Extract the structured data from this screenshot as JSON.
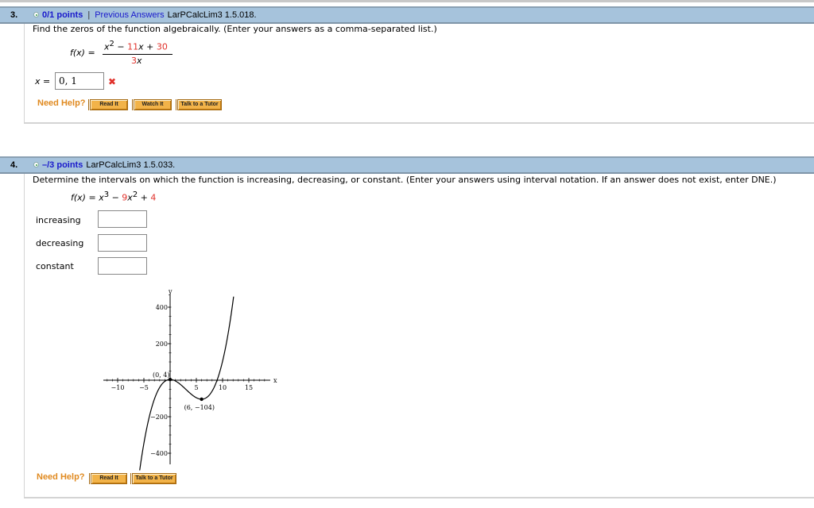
{
  "questions": [
    {
      "number": "3.",
      "points": "0/1 points",
      "separator": "|",
      "previous_answers": "Previous Answers",
      "reference": "LarPCalcLim3 1.5.018.",
      "prompt": "Find the zeros of the function algebraically. (Enter your answers as a comma-separated list.)",
      "function": {
        "lhs": "f(x) =",
        "numerator_parts": [
          "x",
          "2",
          " − ",
          "11",
          "x",
          " + ",
          "30"
        ],
        "denominator_parts": [
          "3",
          "x"
        ]
      },
      "answer_label": "x =",
      "answer_value": "0, 1",
      "answer_status": "incorrect",
      "status_icon": "✖",
      "help_label": "Need Help?",
      "help_buttons": [
        "Read It",
        "Watch It",
        "Talk to a Tutor"
      ]
    },
    {
      "number": "4.",
      "points": "–/3 points",
      "reference": "LarPCalcLim3 1.5.033.",
      "prompt": "Determine the intervals on which the function is increasing, decreasing, or constant. (Enter your answers using interval notation. If an answer does not exist, enter DNE.)",
      "function": {
        "lhs": "f(x) =",
        "parts": [
          "x",
          "3",
          " − ",
          "9",
          "x",
          "2",
          " + ",
          "4"
        ]
      },
      "fields": [
        {
          "label": "increasing",
          "value": ""
        },
        {
          "label": "decreasing",
          "value": ""
        },
        {
          "label": "constant",
          "value": ""
        }
      ],
      "help_label": "Need Help?",
      "help_buttons": [
        "Read It",
        "Talk to a Tutor"
      ]
    }
  ],
  "colors": {
    "header_bg": "#a6c3dc",
    "points_link": "#1a1acc",
    "coefficient_red": "#e0302a",
    "need_help": "#e08a20",
    "help_button": "#f2b349"
  },
  "chart_data": {
    "type": "line",
    "function": "x^3 - 9x^2 + 4",
    "xlabel": "x",
    "ylabel": "y",
    "xlim": [
      -12,
      18
    ],
    "ylim": [
      -450,
      450
    ],
    "x_ticks": [
      -10,
      -5,
      5,
      10,
      15
    ],
    "y_ticks": [
      400,
      200,
      -200,
      -400
    ],
    "x_tick_labels": [
      "−10",
      "−5",
      "5",
      "10",
      "15"
    ],
    "y_tick_labels": [
      "400",
      "200",
      "−200",
      "−400"
    ],
    "points": [
      {
        "x": 0,
        "y": 4,
        "label": "(0, 4)"
      },
      {
        "x": 6,
        "y": -104,
        "label": "(6, −104)"
      }
    ],
    "curve_x_range": [
      -5.8,
      12.1
    ],
    "grid": false
  }
}
